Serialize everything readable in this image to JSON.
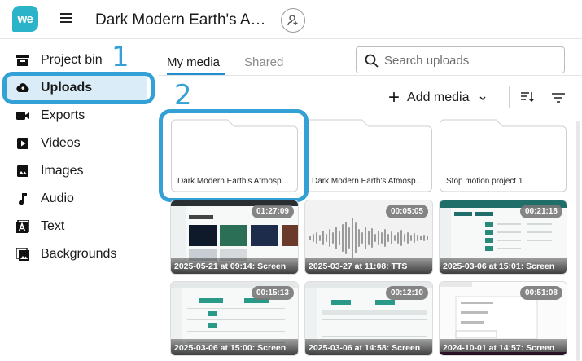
{
  "header": {
    "logo_text": "we",
    "title": "Dark Modern Earth's Atmosphere",
    "icons": [
      "menu-icon",
      "add-person-icon"
    ]
  },
  "sidebar": {
    "items": [
      {
        "label": "Project bin",
        "icon": "archive-icon"
      },
      {
        "label": "Uploads",
        "icon": "cloud-upload-icon",
        "active": true
      },
      {
        "label": "Exports",
        "icon": "video-camera-icon"
      },
      {
        "label": "Videos",
        "icon": "play-icon"
      },
      {
        "label": "Images",
        "icon": "image-icon"
      },
      {
        "label": "Audio",
        "icon": "music-note-icon"
      },
      {
        "label": "Text",
        "icon": "text-icon"
      },
      {
        "label": "Backgrounds",
        "icon": "background-icon"
      }
    ]
  },
  "annotations": {
    "step1": "1",
    "step2": "2",
    "color": "#33a1d6"
  },
  "tabs": [
    {
      "label": "My media",
      "active": true
    },
    {
      "label": "Shared",
      "active": false
    }
  ],
  "search": {
    "placeholder": "Search uploads",
    "value": ""
  },
  "toolbar": {
    "add_media_label": "Add media"
  },
  "folders": [
    {
      "name": "Dark Modern Earth's Atmosphere"
    },
    {
      "name": "Dark Modern Earth's Atmosphere"
    },
    {
      "name": "Stop motion project 1"
    }
  ],
  "media": [
    {
      "caption": "2025-05-21 at 09:14: Screen",
      "duration": "01:27:09",
      "kind": "screen"
    },
    {
      "caption": "2025-03-27 at 11:08: TTS",
      "duration": "00:05:05",
      "kind": "audio"
    },
    {
      "caption": "2025-03-06 at 15:01: Screen",
      "duration": "00:21:18",
      "kind": "screen"
    },
    {
      "caption": "2025-03-06 at 15:00: Screen",
      "duration": "00:15:13",
      "kind": "screen"
    },
    {
      "caption": "2025-03-06 at 14:58: Screen",
      "duration": "00:12:10",
      "kind": "screen"
    },
    {
      "caption": "2024-10-01 at 14:57: Screen",
      "duration": "00:51:08",
      "kind": "screen"
    }
  ],
  "colors": {
    "accent": "#1f8fd0",
    "logo": "#2bb3c9",
    "active_bg": "#d9ecf8"
  }
}
